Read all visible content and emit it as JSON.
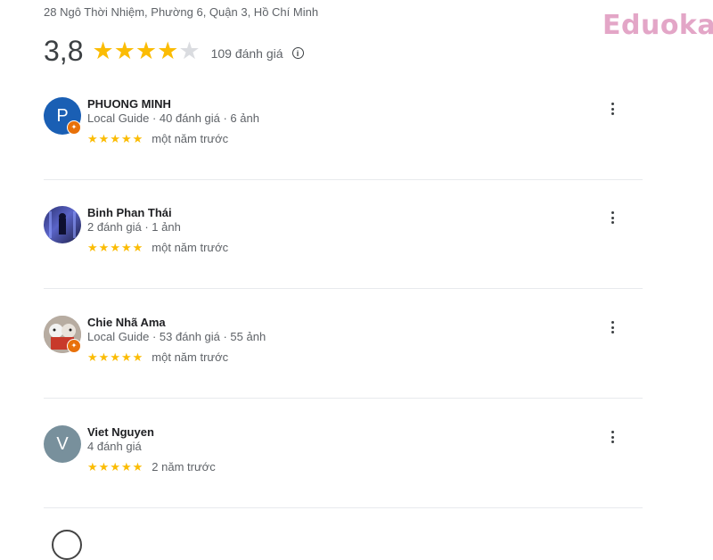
{
  "place": {
    "address": "28 Ngô Thời Nhiệm, Phường 6, Quận 3, Hồ Chí Minh"
  },
  "brand": {
    "watermark": "Eduoka",
    "color": "#e3a6c7"
  },
  "summary": {
    "rating": "3,8",
    "stars_filled": 4,
    "stars_total": 5,
    "review_count": "109 đánh giá",
    "info_icon": "info-icon"
  },
  "colors": {
    "star": "#fbbc04",
    "badge": "#e8710a"
  },
  "reviews": [
    {
      "name": "PHUONG MINH",
      "meta": "Local Guide · 40 đánh giá · 6 ảnh",
      "avatar_letter": "P",
      "avatar_color": "#1a5fb4",
      "local_guide": true,
      "stars": 5,
      "time": "một năm trước"
    },
    {
      "name": "Binh Phan Thái",
      "meta": "2 đánh giá · 1 ảnh",
      "avatar_letter": "",
      "avatar_color": "#3b3f8f",
      "local_guide": false,
      "stars": 5,
      "time": "một năm trước"
    },
    {
      "name": "Chie Nhã Ama",
      "meta": "Local Guide · 53 đánh giá · 55 ảnh",
      "avatar_letter": "",
      "avatar_color": "#8a7d70",
      "local_guide": true,
      "stars": 5,
      "time": "một năm trước"
    },
    {
      "name": "Viet Nguyen",
      "meta": "4 đánh giá",
      "avatar_letter": "V",
      "avatar_color": "#78909c",
      "local_guide": false,
      "stars": 5,
      "time": "2 năm trước"
    }
  ]
}
